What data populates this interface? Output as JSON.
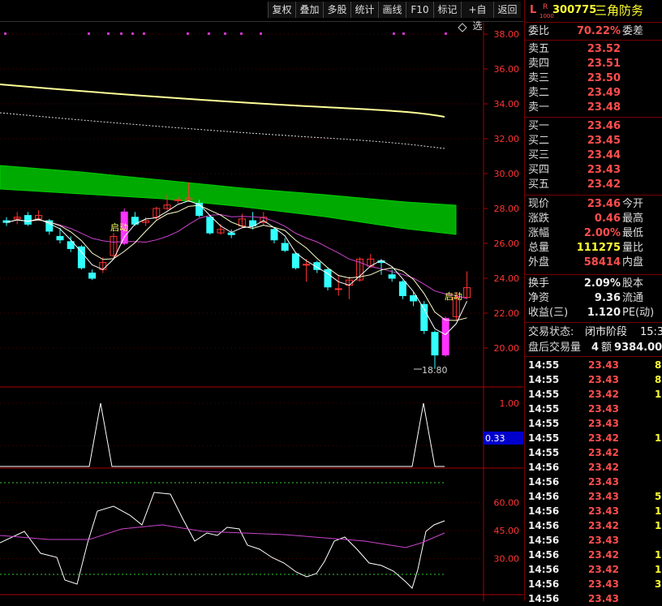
{
  "toolbar": {
    "buttons": [
      "复权",
      "叠加",
      "多股",
      "统计",
      "画线",
      "F10",
      "标记",
      "+自选",
      "返回"
    ]
  },
  "header": {
    "badge_l": "L",
    "badge_r": "R",
    "badge_sub": "1000",
    "code": "300775",
    "name": "三角防务"
  },
  "price_axis": [
    "38.00",
    "36.00",
    "34.00",
    "32.00",
    "30.00",
    "28.00",
    "26.00",
    "24.00",
    "22.00",
    "20.00"
  ],
  "chart_labels": {
    "low_marker": "18.80",
    "qidong_1": "启动",
    "qidong_2": "启动"
  },
  "ind1_axis": {
    "top": "1.00",
    "current": "0.33"
  },
  "ind2_axis": [
    "60.00",
    "45.00",
    "30.00"
  ],
  "quote": {
    "weibi_label": "委比",
    "weibi_value": "70.22%",
    "weicha_label": "委差",
    "asks": [
      {
        "label": "卖五",
        "price": "23.52"
      },
      {
        "label": "卖四",
        "price": "23.51"
      },
      {
        "label": "卖三",
        "price": "23.50"
      },
      {
        "label": "卖二",
        "price": "23.49"
      },
      {
        "label": "卖一",
        "price": "23.48"
      }
    ],
    "bids": [
      {
        "label": "买一",
        "price": "23.46"
      },
      {
        "label": "买二",
        "price": "23.45"
      },
      {
        "label": "买三",
        "price": "23.44"
      },
      {
        "label": "买四",
        "price": "23.43"
      },
      {
        "label": "买五",
        "price": "23.42"
      }
    ],
    "stats": [
      {
        "l": "现价",
        "v": "23.46",
        "r": "今开",
        "cls": "red"
      },
      {
        "l": "涨跌",
        "v": "0.46",
        "r": "最高",
        "cls": "red"
      },
      {
        "l": "涨幅",
        "v": "2.00%",
        "r": "最低",
        "cls": "red"
      },
      {
        "l": "总量",
        "v": "111275",
        "r": "量比",
        "cls": "yel"
      },
      {
        "l": "外盘",
        "v": "58414",
        "r": "内盘",
        "cls": "red"
      }
    ],
    "stats2": [
      {
        "l": "换手",
        "v": "2.09%",
        "r": "股本",
        "cls": "wht"
      },
      {
        "l": "净资",
        "v": "9.36",
        "r": "流通",
        "cls": "wht"
      },
      {
        "l": "收益(三)",
        "v": "1.120",
        "r": "PE(动)",
        "cls": "wht"
      }
    ],
    "trade_status_label": "交易状态:",
    "trade_status_value": "闭市阶段",
    "trade_status_time": "15:3",
    "after_label": "盘后交易量",
    "after_vol": "4",
    "after_amt_label": "额",
    "after_amt": "9384.00"
  },
  "ticks": [
    {
      "t": "14:55",
      "p": "23.43",
      "v": "8"
    },
    {
      "t": "14:55",
      "p": "23.43",
      "v": "8"
    },
    {
      "t": "14:55",
      "p": "23.42",
      "v": "1"
    },
    {
      "t": "14:55",
      "p": "23.43",
      "v": ""
    },
    {
      "t": "14:55",
      "p": "23.43",
      "v": ""
    },
    {
      "t": "14:55",
      "p": "23.42",
      "v": "1"
    },
    {
      "t": "14:55",
      "p": "23.42",
      "v": ""
    },
    {
      "t": "14:56",
      "p": "23.42",
      "v": ""
    },
    {
      "t": "14:56",
      "p": "23.43",
      "v": ""
    },
    {
      "t": "14:56",
      "p": "23.43",
      "v": "5"
    },
    {
      "t": "14:56",
      "p": "23.43",
      "v": "1"
    },
    {
      "t": "14:56",
      "p": "23.42",
      "v": "1"
    },
    {
      "t": "14:56",
      "p": "23.43",
      "v": ""
    },
    {
      "t": "14:56",
      "p": "23.42",
      "v": "1"
    },
    {
      "t": "14:56",
      "p": "23.42",
      "v": "1"
    },
    {
      "t": "14:56",
      "p": "23.43",
      "v": "3"
    },
    {
      "t": "14:56",
      "p": "23.43",
      "v": ""
    }
  ],
  "colors": {
    "up": "#ff3333",
    "down": "#33ffff",
    "band": "#00aa00",
    "ma_yellow": "#ffff99",
    "ma_magenta": "#cc44cc",
    "ma_white": "#ffffff",
    "axis_text": "#ff3333",
    "highlight": "#0000cc"
  },
  "chart_data": {
    "type": "candlestick",
    "ylim": [
      18.0,
      38.8
    ],
    "candles": [
      {
        "o": 27.3,
        "c": 27.2,
        "h": 27.5,
        "l": 27.0
      },
      {
        "o": 27.4,
        "c": 27.5,
        "h": 27.8,
        "l": 27.1
      },
      {
        "o": 27.6,
        "c": 27.1,
        "h": 27.8,
        "l": 27.0
      },
      {
        "o": 27.4,
        "c": 27.6,
        "h": 27.9,
        "l": 27.3
      },
      {
        "o": 27.3,
        "c": 26.7,
        "h": 27.4,
        "l": 26.5
      },
      {
        "o": 26.4,
        "c": 26.2,
        "h": 26.9,
        "l": 26.0
      },
      {
        "o": 26.1,
        "c": 25.7,
        "h": 26.4,
        "l": 25.5
      },
      {
        "o": 25.8,
        "c": 24.6,
        "h": 25.9,
        "l": 24.5
      },
      {
        "o": 24.3,
        "c": 24.0,
        "h": 24.5,
        "l": 23.9
      },
      {
        "o": 24.5,
        "c": 24.9,
        "h": 25.2,
        "l": 24.3
      },
      {
        "o": 25.3,
        "c": 26.4,
        "h": 26.6,
        "l": 25.1
      },
      {
        "o": 26.0,
        "c": 27.8,
        "h": 28.0,
        "l": 25.9
      },
      {
        "o": 27.5,
        "c": 27.1,
        "h": 27.8,
        "l": 27.0
      },
      {
        "o": 27.2,
        "c": 27.3,
        "h": 27.5,
        "l": 27.0
      },
      {
        "o": 27.5,
        "c": 28.0,
        "h": 28.1,
        "l": 27.3
      },
      {
        "o": 28.0,
        "c": 28.2,
        "h": 28.8,
        "l": 27.9
      },
      {
        "o": 28.5,
        "c": 28.5,
        "h": 28.7,
        "l": 28.3
      },
      {
        "o": 28.5,
        "c": 28.6,
        "h": 29.5,
        "l": 28.4
      },
      {
        "o": 28.3,
        "c": 27.6,
        "h": 28.5,
        "l": 27.5
      },
      {
        "o": 27.5,
        "c": 26.6,
        "h": 27.6,
        "l": 26.5
      },
      {
        "o": 26.6,
        "c": 26.8,
        "h": 27.1,
        "l": 26.5
      },
      {
        "o": 26.6,
        "c": 26.5,
        "h": 26.8,
        "l": 26.3
      },
      {
        "o": 27.0,
        "c": 27.4,
        "h": 27.7,
        "l": 26.9
      },
      {
        "o": 27.3,
        "c": 27.0,
        "h": 27.8,
        "l": 26.8
      },
      {
        "o": 27.2,
        "c": 27.5,
        "h": 27.8,
        "l": 27.0
      },
      {
        "o": 26.8,
        "c": 26.2,
        "h": 26.9,
        "l": 26.0
      },
      {
        "o": 26.0,
        "c": 25.6,
        "h": 26.3,
        "l": 25.5
      },
      {
        "o": 25.4,
        "c": 24.6,
        "h": 25.5,
        "l": 24.5
      },
      {
        "o": 24.8,
        "c": 24.8,
        "h": 25.1,
        "l": 23.8
      },
      {
        "o": 24.9,
        "c": 24.5,
        "h": 25.0,
        "l": 24.3
      },
      {
        "o": 24.5,
        "c": 23.5,
        "h": 24.6,
        "l": 23.3
      },
      {
        "o": 23.4,
        "c": 23.4,
        "h": 24.2,
        "l": 23.0
      },
      {
        "o": 23.6,
        "c": 23.9,
        "h": 24.1,
        "l": 22.8
      },
      {
        "o": 23.9,
        "c": 25.1,
        "h": 25.2,
        "l": 23.8
      },
      {
        "o": 24.7,
        "c": 25.1,
        "h": 25.4,
        "l": 24.6
      },
      {
        "o": 25.0,
        "c": 24.9,
        "h": 25.1,
        "l": 24.2
      },
      {
        "o": 24.2,
        "c": 24.0,
        "h": 24.5,
        "l": 23.8
      },
      {
        "o": 23.8,
        "c": 23.0,
        "h": 23.9,
        "l": 22.8
      },
      {
        "o": 23.0,
        "c": 22.7,
        "h": 23.2,
        "l": 22.4
      },
      {
        "o": 22.5,
        "c": 21.0,
        "h": 22.7,
        "l": 20.8
      },
      {
        "o": 20.9,
        "c": 19.6,
        "h": 21.0,
        "l": 18.8
      },
      {
        "o": 19.6,
        "c": 21.7,
        "h": 21.8,
        "l": 19.5
      },
      {
        "o": 21.8,
        "c": 22.9,
        "h": 23.2,
        "l": 21.6
      },
      {
        "o": 22.9,
        "c": 23.46,
        "h": 24.4,
        "l": 22.8
      }
    ]
  }
}
